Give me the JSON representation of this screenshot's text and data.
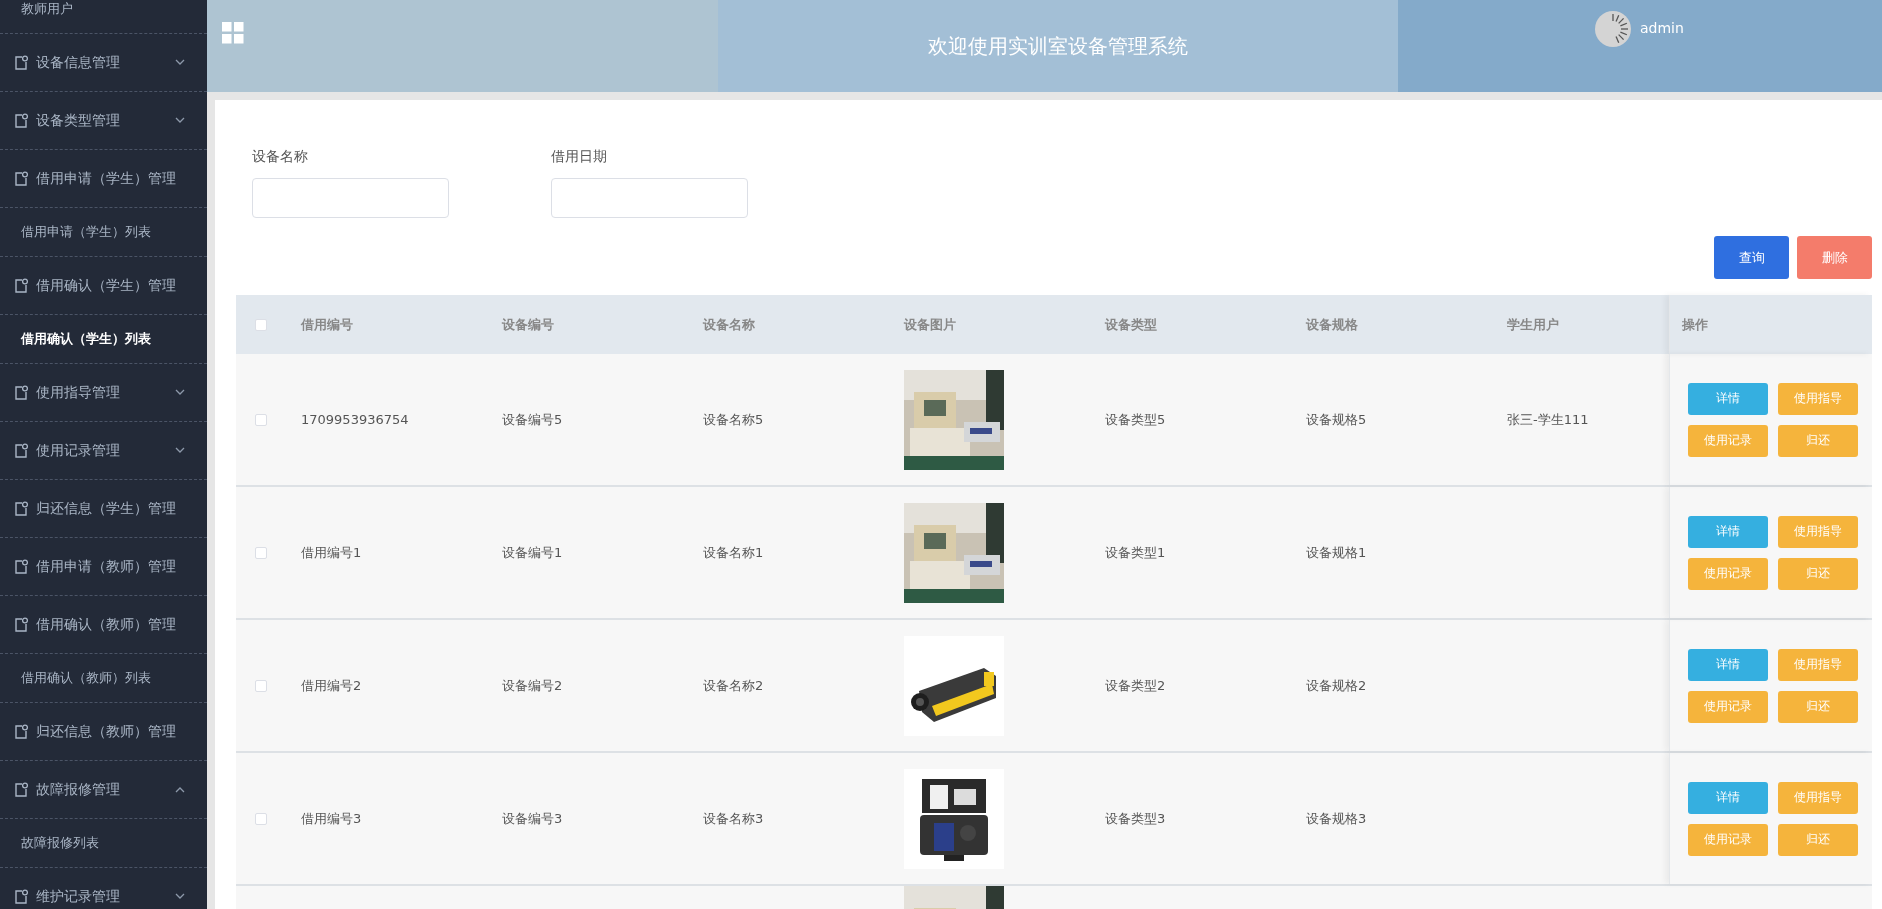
{
  "header": {
    "title": "欢迎使用实训室设备管理系统",
    "user": "admin"
  },
  "sidebar": {
    "items": [
      {
        "label": "教师用户",
        "kind": "link",
        "selected": false
      },
      {
        "label": "设备信息管理",
        "kind": "menu",
        "expanded": false
      },
      {
        "label": "设备类型管理",
        "kind": "menu",
        "expanded": false
      },
      {
        "label": "借用申请（学生）管理",
        "kind": "menu",
        "children": [
          {
            "label": "借用申请（学生）列表",
            "kind": "link",
            "selected": false
          }
        ]
      },
      {
        "label": "借用确认（学生）管理",
        "kind": "menu",
        "children": [
          {
            "label": "借用确认（学生）列表",
            "kind": "link",
            "selected": true
          }
        ]
      },
      {
        "label": "使用指导管理",
        "kind": "menu",
        "expanded": false
      },
      {
        "label": "使用记录管理",
        "kind": "menu",
        "expanded": false
      },
      {
        "label": "归还信息（学生）管理",
        "kind": "menu"
      },
      {
        "label": "借用申请（教师）管理",
        "kind": "menu"
      },
      {
        "label": "借用确认（教师）管理",
        "kind": "menu",
        "children": [
          {
            "label": "借用确认（教师）列表",
            "kind": "link",
            "selected": false
          }
        ]
      },
      {
        "label": "归还信息（教师）管理",
        "kind": "menu"
      },
      {
        "label": "故障报修管理",
        "kind": "menu",
        "expanded": true,
        "children": [
          {
            "label": "故障报修列表",
            "kind": "link",
            "selected": false
          }
        ]
      },
      {
        "label": "维护记录管理",
        "kind": "menu",
        "expanded": false
      }
    ]
  },
  "search": {
    "fields": [
      {
        "label": "设备名称"
      },
      {
        "label": "借用日期"
      }
    ],
    "buttons": [
      {
        "label": "查询",
        "kind": "primary"
      },
      {
        "label": "删除",
        "kind": "danger"
      }
    ]
  },
  "table": {
    "header_checked": false,
    "columns": [
      "借用编号",
      "设备编号",
      "设备名称",
      "设备图片",
      "设备类型",
      "设备规格",
      "学生用户",
      "操作"
    ],
    "rows": [
      {
        "checked": false,
        "borrow_no": "1709953936754",
        "device_no": "设备编号5",
        "device_name": "设备名称5",
        "device_type": "设备类型5",
        "device_spec": "设备规格5",
        "student_user": "张三-学生111",
        "actions": [
          {
            "label": "详情",
            "kind": "info"
          },
          {
            "label": "使用指导",
            "kind": "warning"
          },
          {
            "label": "使用记录",
            "kind": "warning"
          },
          {
            "label": "归还",
            "kind": "warning"
          }
        ]
      },
      {
        "checked": false,
        "borrow_no": "借用编号1",
        "device_no": "设备编号1",
        "device_name": "设备名称1",
        "device_type": "设备类型1",
        "device_spec": "设备规格1",
        "actions": [
          {
            "label": "详情",
            "kind": "info"
          },
          {
            "label": "使用指导",
            "kind": "warning"
          },
          {
            "label": "使用记录",
            "kind": "warning"
          },
          {
            "label": "归还",
            "kind": "warning"
          }
        ]
      },
      {
        "checked": false,
        "borrow_no": "借用编号2",
        "device_no": "设备编号2",
        "device_name": "设备名称2",
        "device_type": "设备类型2",
        "device_spec": "设备规格2",
        "actions": [
          {
            "label": "详情",
            "kind": "info"
          },
          {
            "label": "使用指导",
            "kind": "warning"
          },
          {
            "label": "使用记录",
            "kind": "warning"
          },
          {
            "label": "归还",
            "kind": "warning"
          }
        ]
      },
      {
        "checked": false,
        "borrow_no": "借用编号3",
        "device_no": "设备编号3",
        "device_name": "设备名称3",
        "device_type": "设备类型3",
        "device_spec": "设备规格3",
        "actions": [
          {
            "label": "详情",
            "kind": "info"
          },
          {
            "label": "使用指导",
            "kind": "warning"
          },
          {
            "label": "使用记录",
            "kind": "warning"
          },
          {
            "label": "归还",
            "kind": "warning"
          }
        ]
      }
    ]
  }
}
